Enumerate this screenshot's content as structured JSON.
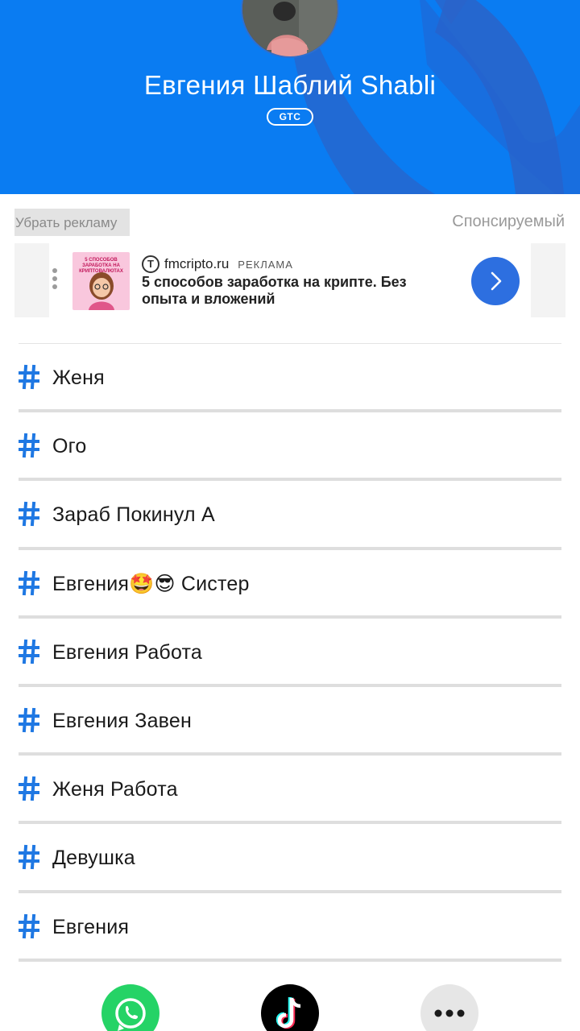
{
  "header": {
    "contact_name": "Евгения Шаблий Shabli",
    "operator": "GTC",
    "colors": {
      "background": "#0a7cf2",
      "decor": "#2a64c9"
    }
  },
  "ad": {
    "remove_ads_label": "Убрать рекламу",
    "sponsored_label": "Спонсируемый",
    "domain": "fmcripto.ru",
    "domain_icon": "fmcripto-logo-icon",
    "ad_label": "РЕКЛАМА",
    "title": "5 способов заработка на крипте. Без опыта и вложений",
    "thumbnail_text": "5 СПОСОБОВ ЗАРАБОТКА НА КРИПТОВАЛЮТАХ",
    "cta_icon": "chevron-right-icon",
    "cta_color": "#2d6fe0"
  },
  "tags": [
    {
      "name": "Женя"
    },
    {
      "name": "Ого"
    },
    {
      "name": "Зараб Покинул А"
    },
    {
      "name": "Евгения🤩😎 Систер"
    },
    {
      "name": "Евгения Работа"
    },
    {
      "name": "Евгения Завен"
    },
    {
      "name": "Женя Работа"
    },
    {
      "name": "Девушка"
    },
    {
      "name": "Евгения"
    }
  ],
  "tag_icon": "hash-icon",
  "tag_icon_color": "#1f78e3",
  "share_buttons": [
    {
      "name": "whatsapp",
      "icon": "whatsapp-icon",
      "color": "#25d366"
    },
    {
      "name": "tiktok",
      "icon": "tiktok-icon",
      "color": "#000000"
    },
    {
      "name": "more",
      "icon": "more-dots-icon",
      "color": "#e6e6e6"
    }
  ]
}
